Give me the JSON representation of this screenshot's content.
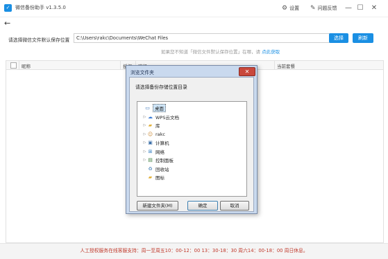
{
  "app": {
    "title": "微信备份助手 v1.3.5.0",
    "logo_glyph": "✓",
    "settings_label": "设置",
    "feedback_label": "问题反馈"
  },
  "window_controls": {
    "minimize": "—",
    "maximize": "☐",
    "close": "✕"
  },
  "back_glyph": "←",
  "path_row": {
    "label": "请选择微信文件默认保存位置",
    "value": "C:\\Users\\rakc\\Documents\\WeChat Files",
    "choose_button": "选择",
    "refresh_button": "刷新"
  },
  "hint": {
    "text": "如果您不知道「微信文件默认保存位置」在哪，请",
    "link": "点此获取"
  },
  "table": {
    "columns": [
      "昵称",
      "授权",
      "路径",
      "当前套餐"
    ]
  },
  "footer": {
    "text": "人工授权服务在线客服支持：周一至周五10：00-12：00  13：30-18：30   周六14：00-18：00 周日休息。"
  },
  "dialog": {
    "title": "浏览文件夹",
    "close_glyph": "✕",
    "prompt": "请选择备份存储位置目录",
    "tree": [
      {
        "label": "桌面",
        "icon": "desktop-icon",
        "glyph": "▭",
        "color": "#2f6db5",
        "indent": 0,
        "expandable": false,
        "selected": true
      },
      {
        "label": "WPS云文档",
        "icon": "cloud-icon",
        "glyph": "☁",
        "color": "#3a7bd5",
        "indent": 1,
        "expandable": true,
        "selected": false
      },
      {
        "label": "库",
        "icon": "library-folder-icon",
        "glyph": "▰",
        "color": "#e2b23c",
        "indent": 1,
        "expandable": true,
        "selected": false
      },
      {
        "label": "rakc",
        "icon": "user-folder-icon",
        "glyph": "☺",
        "color": "#c9862d",
        "indent": 1,
        "expandable": true,
        "selected": false
      },
      {
        "label": "计算机",
        "icon": "computer-icon",
        "glyph": "▣",
        "color": "#3b6fa8",
        "indent": 1,
        "expandable": true,
        "selected": false
      },
      {
        "label": "网络",
        "icon": "network-icon",
        "glyph": "⊞",
        "color": "#2e7bbf",
        "indent": 1,
        "expandable": true,
        "selected": false
      },
      {
        "label": "控制面板",
        "icon": "control-panel-icon",
        "glyph": "▤",
        "color": "#3d7d3d",
        "indent": 1,
        "expandable": true,
        "selected": false
      },
      {
        "label": "回收站",
        "icon": "recycle-bin-icon",
        "glyph": "♻",
        "color": "#5a8fbf",
        "indent": 1,
        "expandable": false,
        "selected": false
      },
      {
        "label": "图标",
        "icon": "folder-icon",
        "glyph": "▰",
        "color": "#e2b23c",
        "indent": 1,
        "expandable": false,
        "selected": false
      }
    ],
    "new_folder_button": "新建文件夹(M)",
    "ok_button": "确定",
    "cancel_button": "取消"
  },
  "colors": {
    "accent": "#1a8fe3",
    "footer_text": "#c0392b",
    "dialog_frame": "#c9d9ee"
  }
}
